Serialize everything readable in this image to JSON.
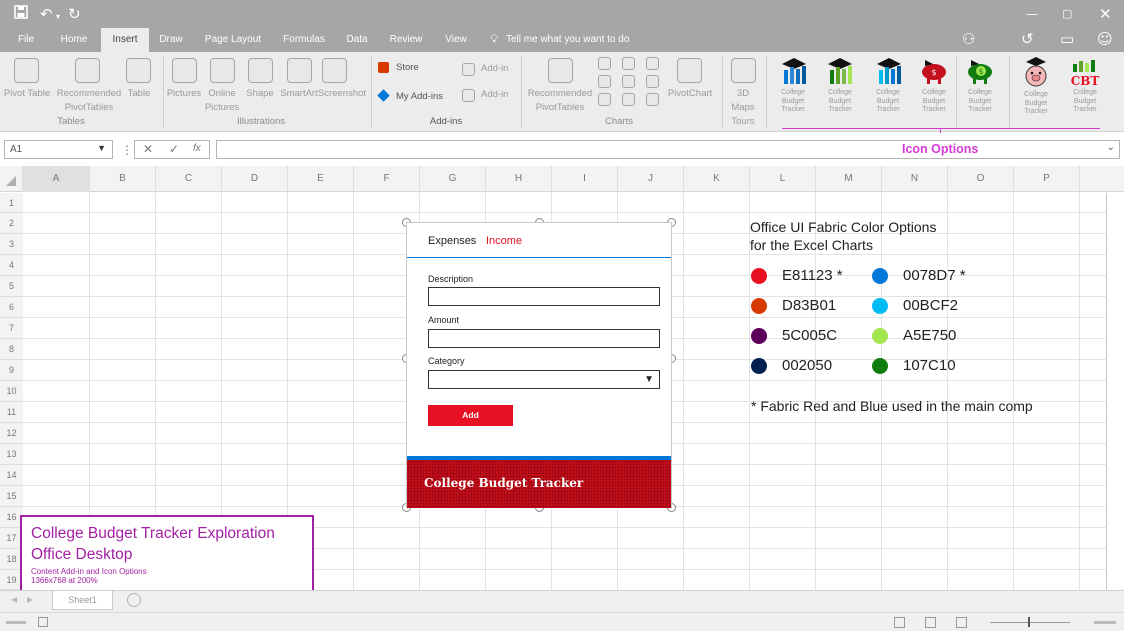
{
  "ribbon_tabs": [
    "File",
    "Home",
    "Insert",
    "Draw",
    "Page Layout",
    "Formulas",
    "Data",
    "Review",
    "View"
  ],
  "tell_me": "Tell me what you want to do",
  "ribbon": {
    "pivot_table": "Pivot Table",
    "recommended_pivot": [
      "Recommended",
      "PivotTables"
    ],
    "table": "Table",
    "tables_group": "Tables",
    "pictures": "Pictures",
    "online_pictures": [
      "Online",
      "Pictures"
    ],
    "shape": "Shape",
    "smartart": "SmartArt",
    "screenshot": "Screenshot",
    "illustrations_group": "Illustrations",
    "store": "Store",
    "my_addins": "My Add-ins",
    "addin_1": "Add-in",
    "addin_2": "Add-in",
    "addins_group": "Add-ins",
    "recommended_charts": [
      "Recommended",
      "PivotTables"
    ],
    "charts_group": "Charts",
    "pivotchart": "PivotChart",
    "maps_3d": [
      "3D",
      "Maps",
      "Tours"
    ],
    "icon_label": [
      "College",
      "Budget",
      "Tracker"
    ],
    "icon_options": "Icon Options"
  },
  "formula_bar": {
    "name_box": "A1",
    "cancel": "✕",
    "enter": "✓",
    "fx": "fx"
  },
  "columns": [
    "A",
    "B",
    "C",
    "D",
    "E",
    "F",
    "G",
    "H",
    "I",
    "J",
    "K",
    "L",
    "M",
    "N",
    "O",
    "P"
  ],
  "rows": [
    "1",
    "2",
    "3",
    "4",
    "5",
    "6",
    "7",
    "8",
    "9",
    "10",
    "11",
    "12",
    "13",
    "14",
    "15",
    "16",
    "17",
    "18",
    "19"
  ],
  "addin": {
    "tab_expenses": "Expenses",
    "tab_income": "Income",
    "description_label": "Description",
    "amount_label": "Amount",
    "category_label": "Category",
    "add_button": "Add",
    "banner_text": "College Budget Tracker"
  },
  "colors_panel": {
    "title_line1": "Office UI Fabric Color Options",
    "title_line2": "for the Excel Charts",
    "colors": [
      {
        "hex": "E81123",
        "star": "*",
        "color": "#E81123"
      },
      {
        "hex": "0078D7",
        "star": "*",
        "color": "#0078D7"
      },
      {
        "hex": "D83B01",
        "star": "",
        "color": "#D83B01"
      },
      {
        "hex": "00BCF2",
        "star": "",
        "color": "#00BCF2"
      },
      {
        "hex": "5C005C",
        "star": "",
        "color": "#5C005C"
      },
      {
        "hex": "A5E750",
        "star": "",
        "color": "#A5E750"
      },
      {
        "hex": "002050",
        "star": "",
        "color": "#002050"
      },
      {
        "hex": "107C10",
        "star": "",
        "color": "#107C10"
      }
    ],
    "footnote": "* Fabric Red and Blue used in the main comp"
  },
  "annotation": {
    "title1": "College Budget Tracker Exploration",
    "title2": "Office Desktop",
    "sub1": "Content Add-in and Icon Options",
    "sub2": "1366x768 at 200%"
  },
  "sheet_tab": "Sheet1",
  "accent_colors": {
    "fabric_red": "#E81123",
    "fabric_blue": "#0078D7",
    "annotation_magenta": "#a31fa3",
    "icon_options_magenta": "#d63ad6"
  }
}
